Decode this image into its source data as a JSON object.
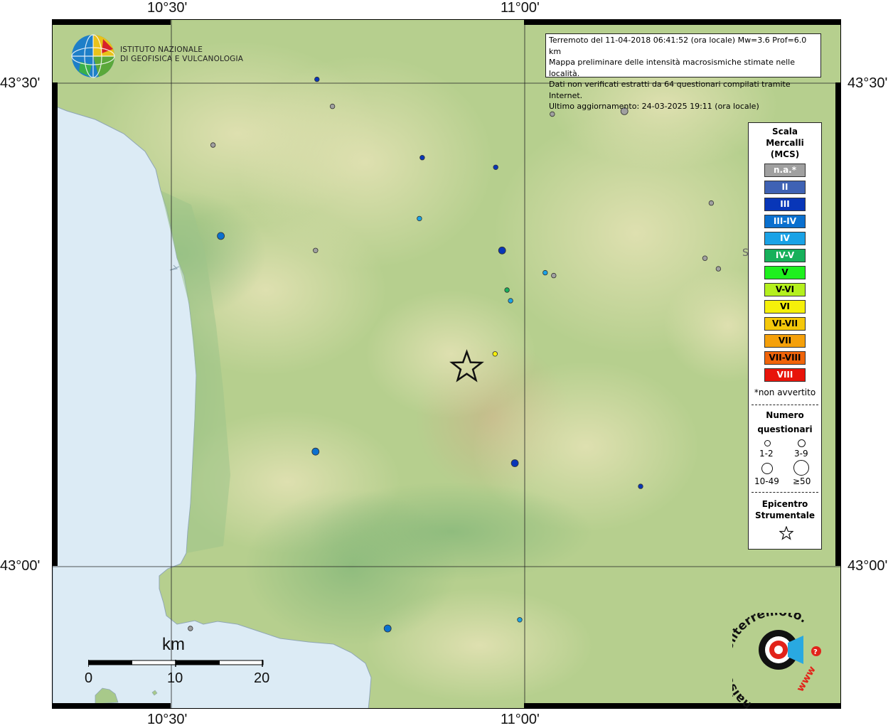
{
  "map": {
    "title_lines": [
      "Terremoto del 11-04-2018 06:41:52 (ora locale) Mw=3.6 Prof=6.0 km",
      "Mappa preliminare delle intensità macrosismiche stimate nelle località.",
      "Dati non verificati estratti da 64 questionari compilati tramite Internet.",
      "Ultimo aggiornamento: 24-03-2025 19:11 (ora locale)"
    ],
    "lon_labels": [
      "10°30'",
      "11°00'"
    ],
    "lat_labels": [
      "43°30'",
      "43°00'"
    ],
    "partial_place_label": "S"
  },
  "logo_ingv": {
    "lines": [
      "ISTITUTO NAZIONALE",
      "DI GEOFISICA E VULCANOLOGIA"
    ]
  },
  "logo_hsit": {
    "text": "haisentitoilterremoto.it",
    "url_text": "www"
  },
  "legend": {
    "title_lines": [
      "Scala",
      "Mercalli",
      "(MCS)"
    ],
    "classes": [
      {
        "label": "n.a.*",
        "color": "#a0a0a0",
        "text_color": "#ffffff"
      },
      {
        "label": "II",
        "color": "#3f62b4",
        "text_color": "#ffffff"
      },
      {
        "label": "III",
        "color": "#0836b8",
        "text_color": "#ffffff"
      },
      {
        "label": "III-IV",
        "color": "#0a70cf",
        "text_color": "#ffffff"
      },
      {
        "label": "IV",
        "color": "#1aa2e6",
        "text_color": "#ffffff"
      },
      {
        "label": "IV-V",
        "color": "#16b05a",
        "text_color": "#ffffff"
      },
      {
        "label": "V",
        "color": "#1ef01e",
        "text_color": "#000000"
      },
      {
        "label": "V-VI",
        "color": "#b4f01e",
        "text_color": "#000000"
      },
      {
        "label": "VI",
        "color": "#f5f00a",
        "text_color": "#000000"
      },
      {
        "label": "VI-VII",
        "color": "#f5c80a",
        "text_color": "#000000"
      },
      {
        "label": "VII",
        "color": "#f5a00a",
        "text_color": "#000000"
      },
      {
        "label": "VII-VIII",
        "color": "#f0640a",
        "text_color": "#000000"
      },
      {
        "label": "VIII",
        "color": "#e8140a",
        "text_color": "#ffffff"
      }
    ],
    "note": "*non avvertito",
    "count_title_lines": [
      "Numero",
      "questionari"
    ],
    "count_classes": [
      "1-2",
      "3-9",
      "10-49",
      "≥50"
    ],
    "epicenter_title_lines": [
      "Epicentro",
      "Strumentale"
    ]
  },
  "scale_bar": {
    "unit": "km",
    "labels": [
      "0",
      "10",
      "20"
    ]
  },
  "observations": [
    {
      "lon": 10.706,
      "lat": 43.504,
      "intensity": "III",
      "count_class": "1-2"
    },
    {
      "lon": 10.728,
      "lat": 43.476,
      "intensity": "n.a.",
      "count_class": "1-2"
    },
    {
      "lon": 11.039,
      "lat": 43.468,
      "intensity": "n.a.",
      "count_class": "1-2"
    },
    {
      "lon": 11.141,
      "lat": 43.471,
      "intensity": "n.a.",
      "count_class": "3-9"
    },
    {
      "lon": 10.559,
      "lat": 43.436,
      "intensity": "n.a.",
      "count_class": "1-2"
    },
    {
      "lon": 10.855,
      "lat": 43.423,
      "intensity": "III",
      "count_class": "1-2"
    },
    {
      "lon": 10.959,
      "lat": 43.413,
      "intensity": "III",
      "count_class": "1-2"
    },
    {
      "lon": 11.264,
      "lat": 43.376,
      "intensity": "n.a.",
      "count_class": "1-2"
    },
    {
      "lon": 10.851,
      "lat": 43.36,
      "intensity": "IV",
      "count_class": "1-2"
    },
    {
      "lon": 10.57,
      "lat": 43.342,
      "intensity": "III-IV",
      "count_class": "3-9"
    },
    {
      "lon": 10.704,
      "lat": 43.327,
      "intensity": "n.a.",
      "count_class": "1-2"
    },
    {
      "lon": 10.968,
      "lat": 43.327,
      "intensity": "III",
      "count_class": "3-9"
    },
    {
      "lon": 11.255,
      "lat": 43.319,
      "intensity": "n.a.",
      "count_class": "1-2"
    },
    {
      "lon": 11.274,
      "lat": 43.308,
      "intensity": "n.a.",
      "count_class": "1-2"
    },
    {
      "lon": 11.041,
      "lat": 43.301,
      "intensity": "n.a.",
      "count_class": "1-2"
    },
    {
      "lon": 11.029,
      "lat": 43.304,
      "intensity": "IV",
      "count_class": "1-2"
    },
    {
      "lon": 10.975,
      "lat": 43.286,
      "intensity": "IV-V",
      "count_class": "1-2"
    },
    {
      "lon": 10.98,
      "lat": 43.275,
      "intensity": "IV",
      "count_class": "1-2"
    },
    {
      "lon": 10.958,
      "lat": 43.22,
      "intensity": "VI",
      "count_class": "1-2"
    },
    {
      "lon": 10.704,
      "lat": 43.119,
      "intensity": "III-IV",
      "count_class": "3-9"
    },
    {
      "lon": 10.986,
      "lat": 43.107,
      "intensity": "III",
      "count_class": "3-9"
    },
    {
      "lon": 11.164,
      "lat": 43.083,
      "intensity": "III",
      "count_class": "1-2"
    },
    {
      "lon": 10.527,
      "lat": 42.936,
      "intensity": "n.a.",
      "count_class": "1-2"
    },
    {
      "lon": 10.806,
      "lat": 42.936,
      "intensity": "III-IV",
      "count_class": "3-9"
    },
    {
      "lon": 10.993,
      "lat": 42.945,
      "intensity": "IV",
      "count_class": "1-2"
    }
  ],
  "epicenter": {
    "lon": 10.918,
    "lat": 43.206
  }
}
